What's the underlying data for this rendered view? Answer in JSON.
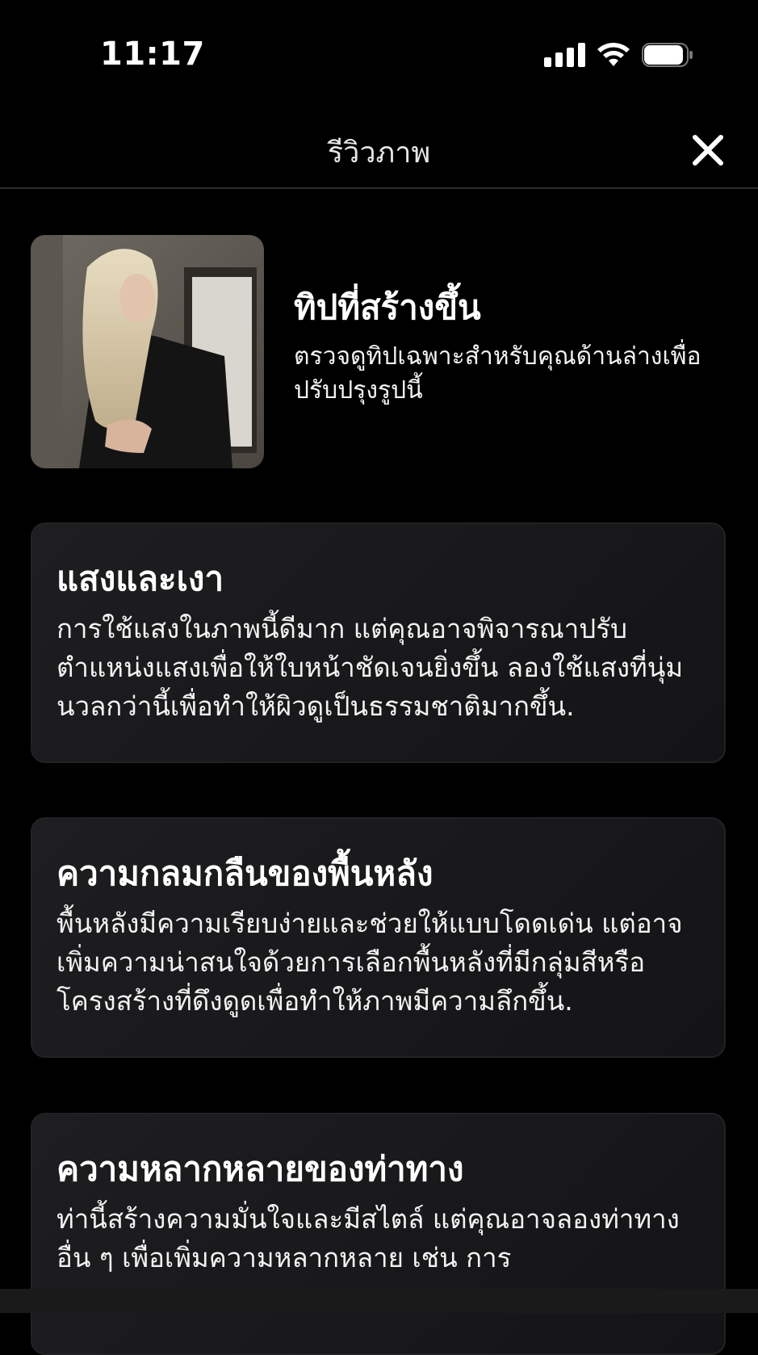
{
  "status_bar": {
    "time": "11:17"
  },
  "header": {
    "title": "รีวิวภาพ"
  },
  "summary": {
    "title": "ทิปที่สร้างขึ้น",
    "description": "ตรวจดูทิปเฉพาะสำหรับคุณด้านล่างเพื่อปรับปรุงรูปนี้"
  },
  "cards": [
    {
      "title": "แสงและเงา",
      "body": "การใช้แสงในภาพนี้ดีมาก แต่คุณอาจพิจารณาปรับตำแหน่งแสงเพื่อให้ใบหน้าชัดเจนยิ่งขึ้น ลองใช้แสงที่นุ่มนวลกว่านี้เพื่อทำให้ผิวดูเป็นธรรมชาติมากขึ้น."
    },
    {
      "title": "ความกลมกลืนของพื้นหลัง",
      "body": "พื้นหลังมีความเรียบง่ายและช่วยให้แบบโดดเด่น แต่อาจเพิ่มความน่าสนใจด้วยการเลือกพื้นหลังที่มีกลุ่มสีหรือโครงสร้างที่ดึงดูดเพื่อทำให้ภาพมีความลึกขึ้น."
    },
    {
      "title": "ความหลากหลายของท่าทาง",
      "body": "ท่านี้สร้างความมั่นใจและมีสไตล์ แต่คุณอาจลองท่าทางอื่น ๆ เพื่อเพิ่มความหลากหลาย เช่น การ"
    }
  ],
  "icons": {
    "close": "close-icon",
    "signal": "signal-icon",
    "wifi": "wifi-icon",
    "battery": "battery-icon"
  },
  "colors": {
    "background": "#000000",
    "card_background": "#1a1a1c",
    "divider": "#2c2c2e",
    "text": "#ffffff"
  }
}
